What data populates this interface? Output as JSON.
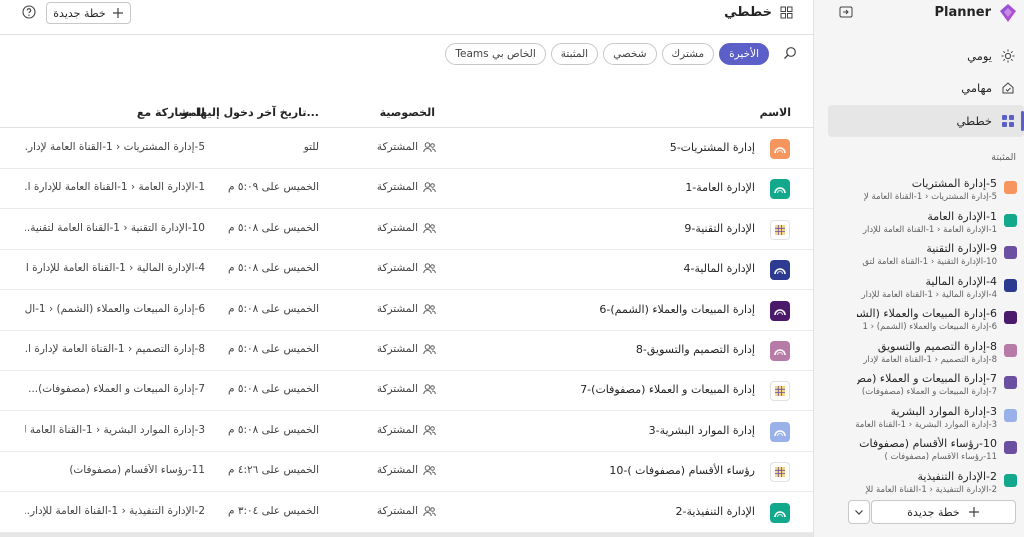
{
  "header": {
    "title": "خططي",
    "new_plan_label": "خطة جديدة"
  },
  "filters": [
    "الأخيرة",
    "مشترك",
    "شخصي",
    "المثبتة",
    "Teams الخاص بي"
  ],
  "active_filter": "الأخيرة",
  "columns": {
    "name": "الاسم",
    "privacy": "الخصوصية",
    "last_access": "تاريخ آخر دخول إليها بو...",
    "shared_with": "المشاركة مع"
  },
  "rows": [
    {
      "name": "5-إدارة المشتريات",
      "privacy": "المشتركة",
      "last_access": "للتو",
      "shared": "5-إدارة المشتريات  ‹  1-القناة العامة لإدار...",
      "icon_color": "#f7955f",
      "icon": "orange-plan-icon"
    },
    {
      "name": "1-الإدارة العامة",
      "privacy": "المشتركة",
      "last_access": "الخميس على ٥:٠٩ م",
      "shared": "1-الإدارة العامة  ‹  1-القناة العامة للإدارة ا...",
      "icon_color": "#12a88c",
      "icon": "teal-plan-icon"
    },
    {
      "name": "9-الإدارة التقنية",
      "privacy": "المشتركة",
      "last_access": "الخميس على ٥:٠٨ م",
      "shared": "10-الإدارة التقنية  ‹  1-القناة العامة لتقنية...",
      "icon_color": "#6b4fa0",
      "icon": "grid-plan-icon"
    },
    {
      "name": "4-الإدارة المالية",
      "privacy": "المشتركة",
      "last_access": "الخميس على ٥:٠٨ م",
      "shared": "4-الإدارة المالية  ‹  1-القناة العامة للإدارة ا...",
      "icon_color": "#2c3a8f",
      "icon": "navy-plan-icon"
    },
    {
      "name": "6-إدارة المبيعات والعملاء (الشمم)",
      "privacy": "المشتركة",
      "last_access": "الخميس على ٥:٠٨ م",
      "shared": "6-إدارة المبيعات والعملاء (الشمم)  ‹  1-ال...",
      "icon_color": "#4b1a6b",
      "icon": "purple-plan-icon"
    },
    {
      "name": "8-إدارة التصميم والتسويق",
      "privacy": "المشتركة",
      "last_access": "الخميس على ٥:٠٨ م",
      "shared": "8-إدارة التصميم  ‹  1-القناة العامة لإدارة ا...",
      "icon_color": "#b67ba6",
      "icon": "mauve-plan-icon"
    },
    {
      "name": "7-إدارة المبيعات و العملاء (مصفوفات)",
      "privacy": "المشتركة",
      "last_access": "الخميس على ٥:٠٨ م",
      "shared": "7-إدارة المبيعات و العملاء (مصفوفات)...",
      "icon_color": "#6b4fa0",
      "icon": "grid-plan-icon"
    },
    {
      "name": "3-إدارة الموارد البشرية",
      "privacy": "المشتركة",
      "last_access": "الخميس على ٥:٠٨ م",
      "shared": "3-إدارة الموارد البشرية  ‹  1-القناة العامة ل...",
      "icon_color": "#9ab0e8",
      "icon": "lightblue-plan-icon"
    },
    {
      "name": "10-رؤساء الأقسام (مصفوفات )",
      "privacy": "المشتركة",
      "last_access": "الخميس على ٤:٢٦ م",
      "shared": "11-رؤساء الأقسام (مصفوفات)",
      "icon_color": "#6b4fa0",
      "icon": "grid-plan-icon"
    },
    {
      "name": "2-الإدارة التنفيذية",
      "privacy": "المشتركة",
      "last_access": "الخميس على ٣:٠٤ م",
      "shared": "2-الإدارة التنفيذية  ‹  1-القناة العامة للإدار...",
      "icon_color": "#12a88c",
      "icon": "teal-plan-icon"
    }
  ],
  "sidebar": {
    "app_name": "Planner",
    "nav": [
      {
        "label": "يومي",
        "icon": "sun-icon"
      },
      {
        "label": "مهامي",
        "icon": "home-icon"
      },
      {
        "label": "خططي",
        "icon": "grid-icon"
      }
    ],
    "selected_nav": "خططي",
    "pinned_label": "المثبتة",
    "pinned": [
      {
        "name": "5-إدارة المشتريات",
        "path": "5-إدارة المشتريات  ‹  1-القناة العامة لإ",
        "icon_color": "#f7955f"
      },
      {
        "name": "1-الإدارة العامة",
        "path": "1-الإدارة العامة  ‹  1-القناة العامة للإدار",
        "icon_color": "#12a88c"
      },
      {
        "name": "9-الإدارة التقنية",
        "path": "10-الإدارة التقنية  ‹  1-القناة العامة لتق",
        "icon_color": "#6b4fa0"
      },
      {
        "name": "4-الإدارة المالية",
        "path": "4-الإدارة المالية  ‹  1-القناة العامة للإدار",
        "icon_color": "#2c3a8f"
      },
      {
        "name": "6-إدارة المبيعات والعملاء (الشم...",
        "path": "6-إدارة المبيعات والعملاء (الشمم)  ‹  1",
        "icon_color": "#4b1a6b"
      },
      {
        "name": "8-إدارة التصميم والتسويق",
        "path": "8-إدارة التصميم  ‹  1-القناة العامة لإدار",
        "icon_color": "#b67ba6"
      },
      {
        "name": "7-إدارة المبيعات و العملاء (مص...",
        "path": "7-إدارة المبيعات و العملاء (مصفوفات)",
        "icon_color": "#6b4fa0"
      },
      {
        "name": "3-إدارة الموارد البشرية",
        "path": "3-إدارة الموارد البشرية  ‹  1-القناة العامة ل",
        "icon_color": "#9ab0e8"
      },
      {
        "name": "10-رؤساء الأقسام (مصفوفات )",
        "path": "11-رؤساء الأقسام (مصفوفات )",
        "icon_color": "#6b4fa0"
      },
      {
        "name": "2-الإدارة التنفيذية",
        "path": "2-الإدارة التنفيذية  ‹  1-القناة العامة للإ",
        "icon_color": "#12a88c"
      }
    ],
    "new_plan_label": "خطة جديدة"
  }
}
